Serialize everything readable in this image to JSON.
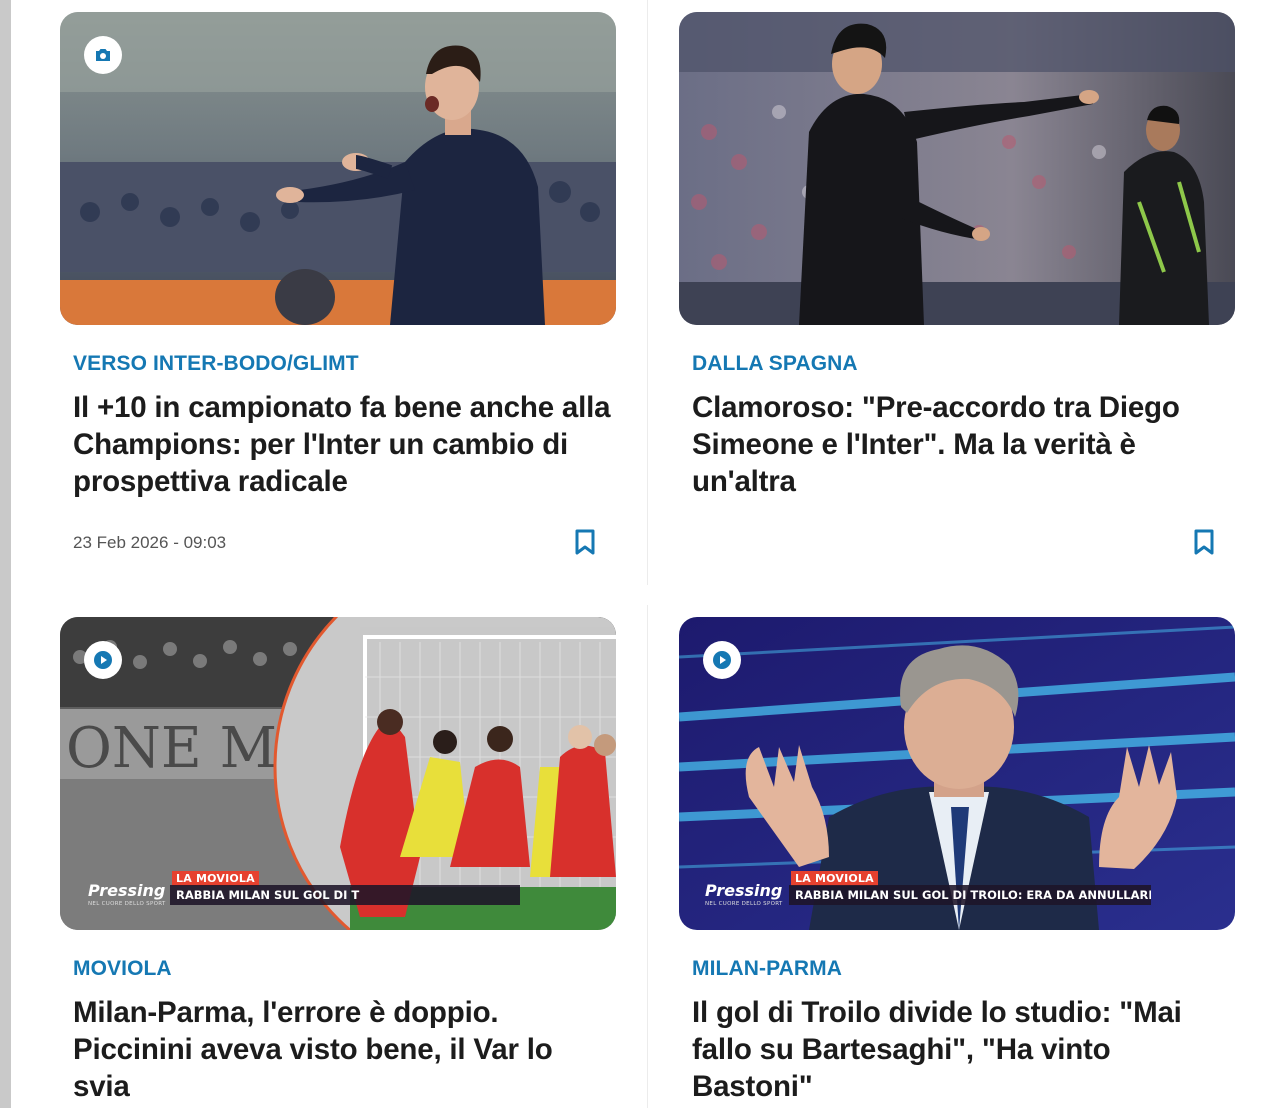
{
  "articles": [
    {
      "category": "VERSO INTER-BODO/GLIMT",
      "title": "Il +10 in campionato fa bene anche alla Champions: per l'Inter un cambio di prospettiva radicale",
      "date": "23 Feb 2026 - 09:03",
      "media_type": "photo",
      "media_icon": "camera-icon",
      "bookmark_icon": "bookmark-icon"
    },
    {
      "category": "DALLA SPAGNA",
      "title": "Clamoroso: \"Pre-accordo tra Diego Simeone e l'Inter\". Ma la verità è un'altra",
      "date": "",
      "media_type": "photo",
      "bookmark_icon": "bookmark-icon"
    },
    {
      "category": "MOVIOLA",
      "title": "Milan-Parma, l'errore è doppio. Piccinini aveva visto bene, il Var lo svia",
      "media_type": "video",
      "media_icon": "play-icon",
      "overlay": {
        "logo": "Pressing",
        "logo_sub": "NEL CUORE DELLO SPORT",
        "tag": "LA MOVIOLA",
        "headline": "RABBIA MILAN SUL GOL DI T"
      }
    },
    {
      "category": "MILAN-PARMA",
      "title": "Il gol di Troilo divide lo studio: \"Mai fallo su Bartesaghi\", \"Ha vinto Bastoni\"",
      "media_type": "video",
      "media_icon": "play-icon",
      "overlay": {
        "logo": "Pressing",
        "logo_sub": "NEL CUORE DELLO SPORT",
        "tag": "LA MOVIOLA",
        "headline": "RABBIA MILAN SUL GOL DI TROILO: ERA DA ANNULLARE?"
      }
    }
  ],
  "colors": {
    "kicker": "#1578b3",
    "title": "#1c1c1c",
    "date": "#555555",
    "bookmark": "#1578b3",
    "overlay_tag": "#e6412f"
  }
}
